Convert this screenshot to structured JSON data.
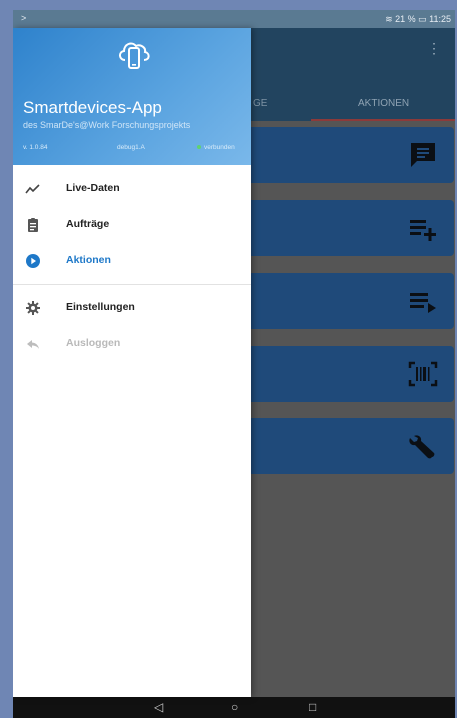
{
  "statusbar": {
    "left_icon": "chevron-icon",
    "right_text": "≋ 21 % ▭ 11:25"
  },
  "appbar": {
    "overflow_icon": "⋮",
    "tab_partial_label": "GE",
    "tab_active_label": "AKTIONEN"
  },
  "action_cards": [
    {
      "icon": "message-icon"
    },
    {
      "icon": "playlist-add-icon"
    },
    {
      "icon": "playlist-play-icon"
    },
    {
      "icon": "barcode-scan-icon"
    },
    {
      "icon": "wrench-icon"
    }
  ],
  "drawer": {
    "title": "Smartdevices-App",
    "subtitle": "des SmarDe's@Work Forschungsprojekts",
    "version": "v. 1.0.84",
    "build": "debug1.A",
    "connection": "verbunden",
    "colors": {
      "header_start": "#2e82cc",
      "header_end": "#7ab8ea",
      "active": "#1e78c8",
      "connected": "#5fd36f"
    },
    "menu": [
      {
        "label": "Live-Daten",
        "icon": "trending-icon",
        "state": "normal"
      },
      {
        "label": "Aufträge",
        "icon": "clipboard-icon",
        "state": "normal"
      },
      {
        "label": "Aktionen",
        "icon": "play-circle-icon",
        "state": "active"
      },
      {
        "label": "Einstellungen",
        "icon": "gear-icon",
        "state": "normal"
      },
      {
        "label": "Ausloggen",
        "icon": "reply-icon",
        "state": "disabled"
      }
    ]
  },
  "navbar": {
    "back": "◁",
    "home": "○",
    "recents": "□"
  }
}
